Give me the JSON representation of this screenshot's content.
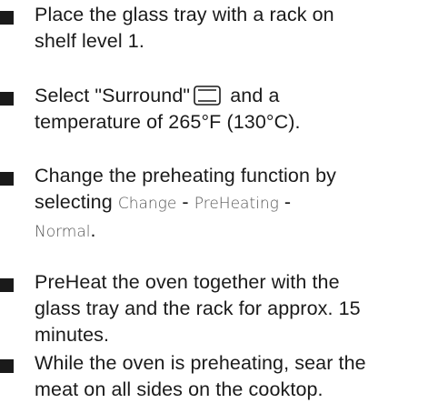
{
  "steps": [
    {
      "line1": "Place the glass tray with a rack on",
      "line2": "shelf level 1."
    },
    {
      "prefix": "Select \"Surround\"",
      "icon": "surround-heat-icon",
      "suffix": " and a",
      "line2": "temperature of 265°F (130°C)."
    },
    {
      "line1": "Change the preheating function by",
      "line2_prefix": "selecting ",
      "term1": "Change",
      "sep1": " - ",
      "term2": "PreHeating",
      "sep2": " -",
      "term3": "Normal",
      "end": "."
    },
    {
      "line1": "PreHeat the oven together with the",
      "line2": "glass tray and the rack for approx. 15",
      "line3": "minutes."
    },
    {
      "line1": "While the oven is preheating, sear the",
      "line2": "meat on all sides on the cooktop."
    }
  ],
  "colors": {
    "text": "#1a1a1a",
    "ui_term": "#555555"
  }
}
